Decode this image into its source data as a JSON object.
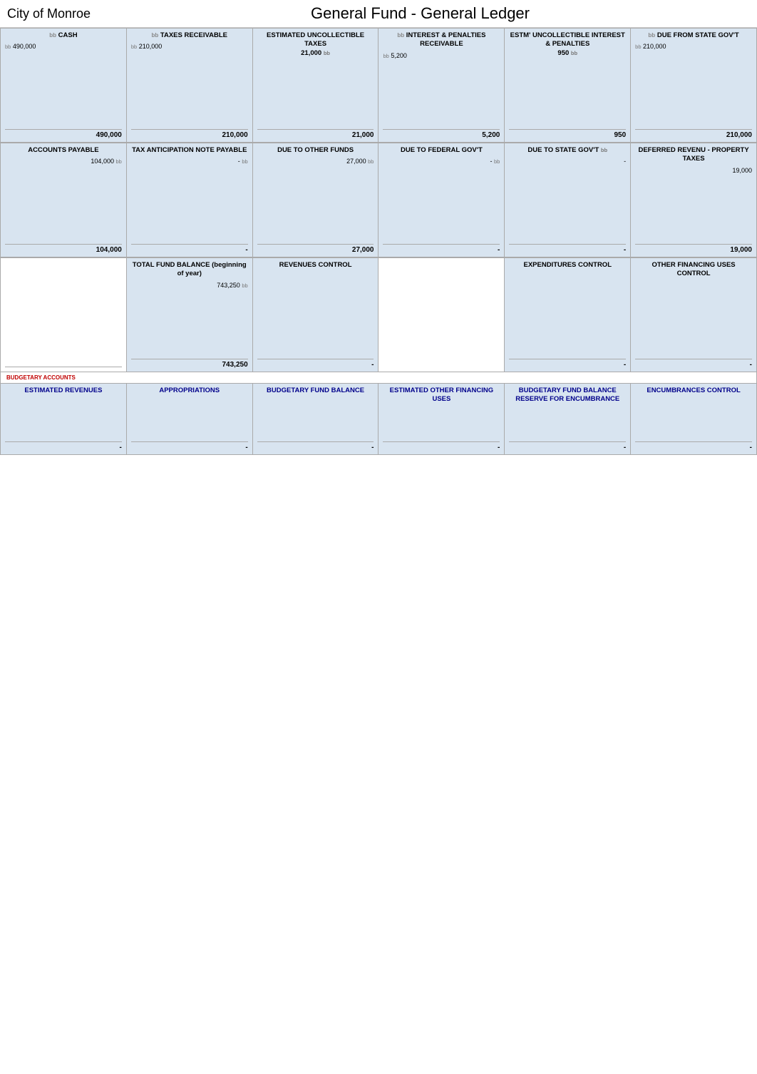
{
  "header": {
    "city": "City of Monroe",
    "title": "General Fund - General Ledger"
  },
  "row1": [
    {
      "id": "cash",
      "label": "CASH",
      "bb_prefix": "bb",
      "amount_top": "490,000",
      "amount_bottom": "490,000",
      "shade": true,
      "entries": []
    },
    {
      "id": "taxes-receivable",
      "label": "TAXES RECEIVABLE",
      "bb_prefix": "bb",
      "amount_top": "210,000",
      "amount_bottom": "210,000",
      "shade": true,
      "entries": []
    },
    {
      "id": "estimated-uncollectible-taxes",
      "label": "ESTIMATED UNCOLLECTIBLE TAXES",
      "amount_top": "21,000",
      "bb_suffix": "bb",
      "amount_bottom": "21,000",
      "shade": true,
      "entries": []
    },
    {
      "id": "interest-penalties-receivable",
      "label": "INTEREST & PENALTIES RECEIVABLE",
      "bb_prefix": "bb",
      "amount_top": "5,200",
      "amount_bottom": "5,200",
      "shade": true,
      "entries": []
    },
    {
      "id": "estm-uncollectible-interest",
      "label": "ESTM' UNCOLLECTIBLE INTEREST & PENALTIES",
      "amount_top": "950",
      "bb_suffix": "bb",
      "amount_bottom": "950",
      "shade": true,
      "entries": []
    },
    {
      "id": "due-from-state",
      "label": "DUE FROM STATE GOV'T",
      "bb_prefix": "bb",
      "amount_top": "210,000",
      "amount_bottom": "210,000",
      "shade": true,
      "entries": []
    }
  ],
  "row2": [
    {
      "id": "accounts-payable",
      "label": "ACCOUNTS PAYABLE",
      "bb_suffix": "bb",
      "amount_top": "104,000",
      "amount_bottom": "104,000",
      "shade": true,
      "entries": []
    },
    {
      "id": "tax-anticipation-note",
      "label": "TAX ANTICIPATION NOTE PAYABLE",
      "amount_top": "-",
      "bb_suffix": "bb",
      "amount_bottom": "-",
      "shade": true,
      "entries": []
    },
    {
      "id": "due-to-other-funds",
      "label": "DUE TO OTHER FUNDS",
      "amount_top": "27,000",
      "bb_suffix": "bb",
      "amount_bottom": "27,000",
      "shade": true,
      "entries": []
    },
    {
      "id": "due-to-federal",
      "label": "DUE TO FEDERAL GOV'T",
      "amount_top": "-",
      "bb_suffix": "bb",
      "amount_bottom": "-",
      "shade": true,
      "entries": []
    },
    {
      "id": "due-to-state",
      "label": "DUE TO STATE GOV'T",
      "bb_suffix": "bb",
      "amount_top": "-",
      "amount_bottom": "-",
      "shade": true,
      "entries": []
    },
    {
      "id": "deferred-revenue",
      "label": "DEFERRED REVENU - PROPERTY TAXES",
      "amount_top": "19,000",
      "amount_bottom": "19,000",
      "shade": true,
      "entries": []
    }
  ],
  "row3": [
    {
      "id": "empty-row3-1",
      "label": "",
      "amount_bottom": "",
      "shade": false,
      "entries": []
    },
    {
      "id": "total-fund-balance",
      "label": "TOTAL FUND BALANCE (beginning of year)",
      "amount_top": "743,250",
      "bb_suffix": "bb",
      "amount_bottom": "743,250",
      "shade": true,
      "entries": []
    },
    {
      "id": "revenues-control",
      "label": "REVENUES CONTROL",
      "amount_bottom": "-",
      "shade": true,
      "entries": []
    },
    {
      "id": "empty-row3-4",
      "label": "",
      "amount_bottom": "",
      "shade": false,
      "entries": []
    },
    {
      "id": "expenditures-control",
      "label": "EXPENDITURES CONTROL",
      "amount_bottom": "-",
      "shade": true,
      "entries": []
    },
    {
      "id": "other-financing-uses",
      "label": "OTHER FINANCING USES CONTROL",
      "amount_bottom": "-",
      "shade": true,
      "entries": []
    }
  ],
  "budgetary": {
    "section_label": "BUDGETARY ACCOUNTS",
    "cells": [
      {
        "id": "estimated-revenues",
        "label": "ESTIMATED REVENUES",
        "amount_bottom": "-",
        "shade": true
      },
      {
        "id": "appropriations",
        "label": "APPROPRIATIONS",
        "amount_bottom": "-",
        "shade": true
      },
      {
        "id": "budgetary-fund-balance",
        "label": "BUDGETARY FUND BALANCE",
        "amount_bottom": "-",
        "shade": true
      },
      {
        "id": "estimated-other-financing",
        "label": "ESTIMATED OTHER FINANCING USES",
        "amount_bottom": "-",
        "shade": true
      },
      {
        "id": "budgetary-fund-balance-reserve",
        "label": "BUDGETARY FUND BALANCE RESERVE FOR ENCUMBRANCE",
        "amount_bottom": "-",
        "shade": true
      },
      {
        "id": "encumbrances-control",
        "label": "ENCUMBRANCES CONTROL",
        "amount_bottom": "-",
        "shade": true
      }
    ]
  }
}
